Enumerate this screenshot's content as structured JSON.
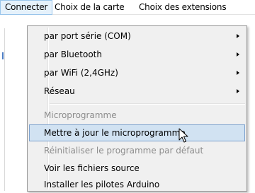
{
  "menubar": {
    "items": [
      {
        "label": "Connecter"
      },
      {
        "label": "Choix de la carte"
      },
      {
        "label": "Choix des extensions"
      }
    ]
  },
  "menu": {
    "items": [
      {
        "label": "par port série (COM)",
        "submenu": true
      },
      {
        "label": "par Bluetooth",
        "submenu": true
      },
      {
        "label": "par WiFi (2,4GHz)",
        "submenu": true
      },
      {
        "label": "Réseau",
        "submenu": true
      },
      {
        "label": "Microprogramme",
        "disabled": true
      },
      {
        "label": "Mettre à jour le microprogramme",
        "highlighted": true
      },
      {
        "label": "Réinitialiser le programme par défaut",
        "disabled": true
      },
      {
        "label": "Voir les fichiers source"
      },
      {
        "label": "Installer les pilotes Arduino"
      }
    ]
  },
  "colors": {
    "highlight": "#d1e2f2",
    "highlight_border": "#7da2ce",
    "disabled_text": "#8d8d8d",
    "menu_background": "#f0f0f0"
  },
  "icons": {
    "cursor": "mouse-pointer-icon",
    "submenu": "chevron-right-icon"
  }
}
